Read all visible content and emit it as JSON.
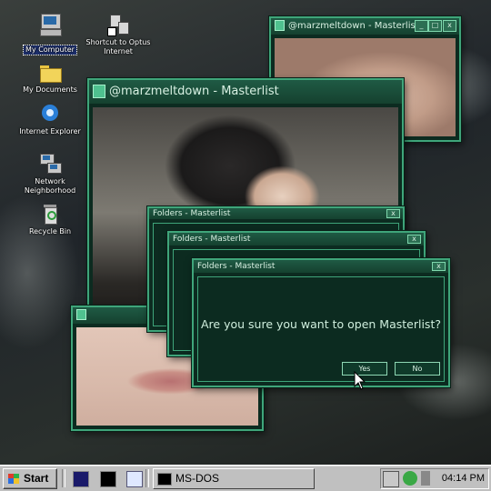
{
  "desktop_icons": [
    {
      "label": "My Computer",
      "icon": "computer-icon"
    },
    {
      "label": "Shortcut to Optus Internet",
      "icon": "network-shortcut-icon"
    },
    {
      "label": "My Documents",
      "icon": "folder-icon"
    },
    {
      "label": "Internet Explorer",
      "icon": "ie-icon"
    },
    {
      "label": "Network Neighborhood",
      "icon": "network-icon"
    },
    {
      "label": "Recycle Bin",
      "icon": "recycle-bin-icon"
    }
  ],
  "windows": {
    "top_right": {
      "title": "@marzmeltdown - Masterlist"
    },
    "main": {
      "title": "@marzmeltdown - Masterlist"
    },
    "folders_1": {
      "title": "Folders - Masterlist"
    },
    "folders_2": {
      "title": "Folders - Masterlist"
    },
    "dialog": {
      "title": "Folders - Masterlist",
      "message": "Are you sure you want to open Masterlist?",
      "yes_label": "Yes",
      "no_label": "No"
    }
  },
  "taskbar": {
    "start_label": "Start",
    "task_label": "MS-DOS",
    "clock": "04:14 PM"
  },
  "colors": {
    "window_bg": "#0c2b20",
    "window_border": "#3fa57a",
    "taskbar": "#c0c0c0"
  }
}
